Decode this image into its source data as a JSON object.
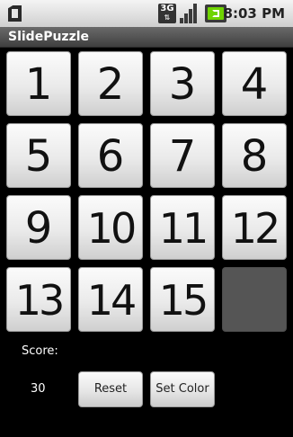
{
  "status_bar": {
    "network": "3G",
    "time": "8:03 PM",
    "icons": [
      "sd-card-icon",
      "3g-icon",
      "signal-icon",
      "battery-icon"
    ]
  },
  "app": {
    "title": "SlidePuzzle"
  },
  "puzzle": {
    "tiles": [
      "1",
      "2",
      "3",
      "4",
      "5",
      "6",
      "7",
      "8",
      "9",
      "10",
      "11",
      "12",
      "13",
      "14",
      "15",
      ""
    ],
    "empty_color": "#555555"
  },
  "score": {
    "label": "Score:",
    "value": "30"
  },
  "buttons": {
    "reset": "Reset",
    "set_color": "Set Color"
  }
}
